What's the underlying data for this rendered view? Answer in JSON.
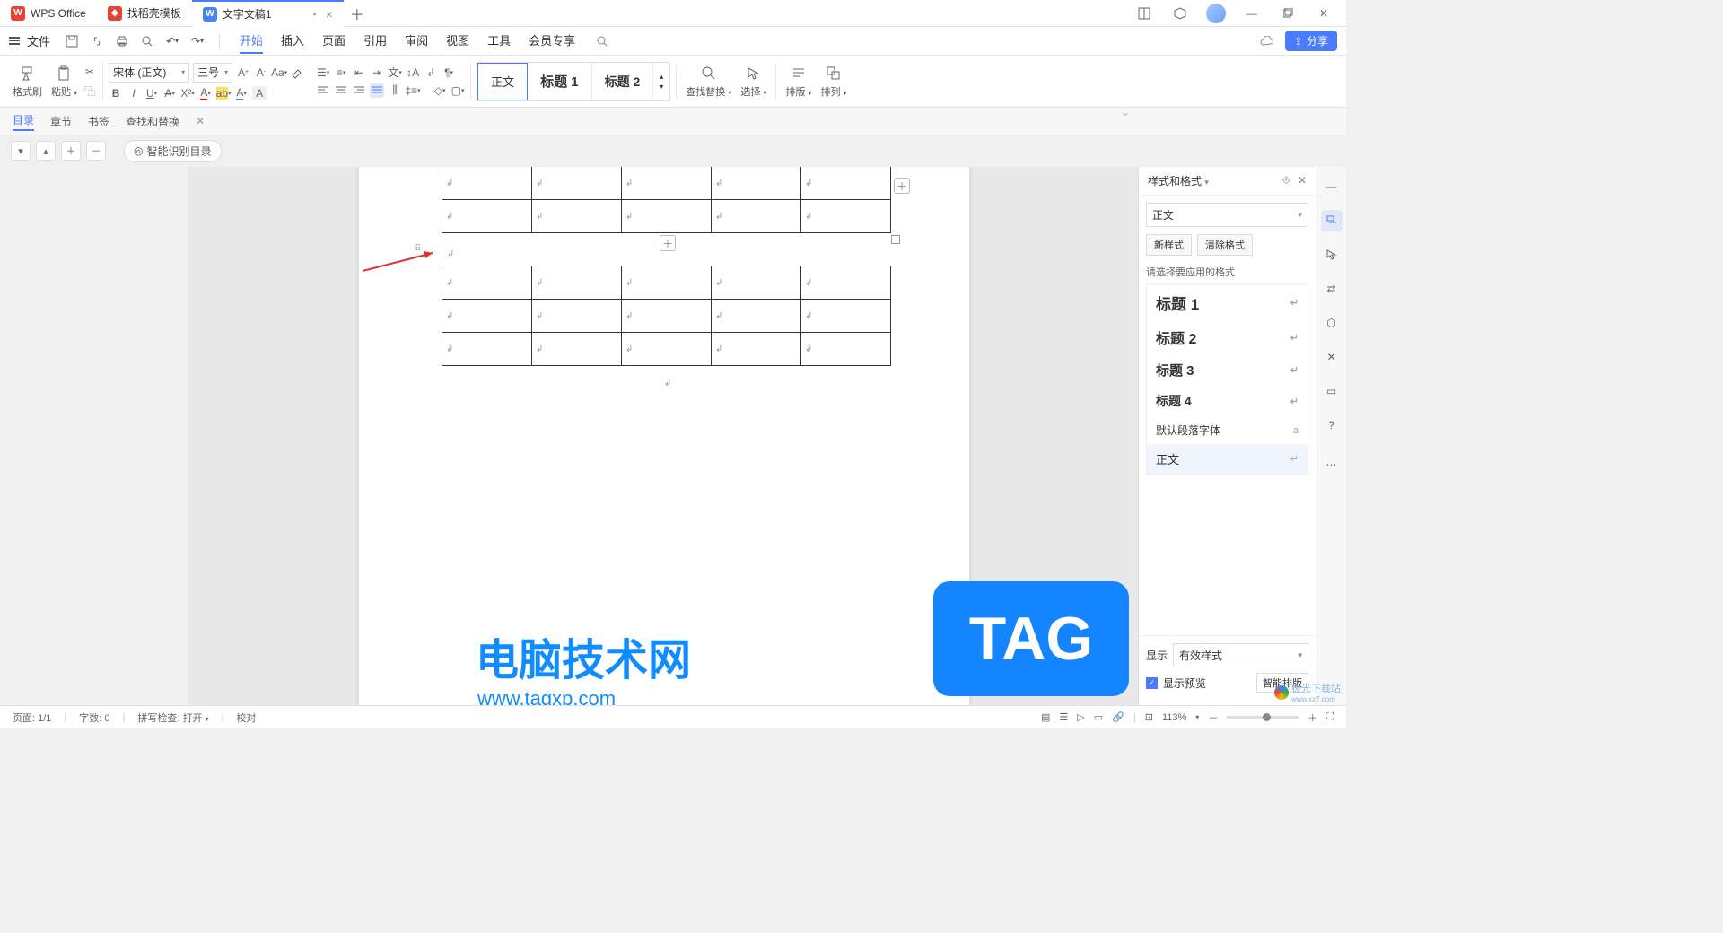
{
  "titlebar": {
    "tabs": [
      {
        "icon": "W",
        "label": "WPS Office"
      },
      {
        "icon": "D",
        "label": "找稻壳模板"
      },
      {
        "icon": "W",
        "label": "文字文稿1"
      }
    ],
    "modified_dot": "•"
  },
  "menubar": {
    "file": "文件",
    "tabs": [
      "开始",
      "插入",
      "页面",
      "引用",
      "审阅",
      "视图",
      "工具",
      "会员专享"
    ],
    "active": "开始",
    "share": "分享"
  },
  "ribbon": {
    "format_brush": "格式刷",
    "paste": "粘贴",
    "font_name": "宋体 (正文)",
    "font_size": "三号",
    "styles": {
      "normal": "正文",
      "h1": "标题 1",
      "h2": "标题 2"
    },
    "find_replace": "查找替换",
    "select": "选择",
    "layout": "排版",
    "arrange": "排列"
  },
  "subtoolbar": {
    "tabs": [
      "目录",
      "章节",
      "书签",
      "查找和替换"
    ],
    "active": "目录"
  },
  "outline": {
    "smart": "智能识别目录"
  },
  "right_panel": {
    "title": "样式和格式",
    "current": "正文",
    "new_style": "新样式",
    "clear_format": "清除格式",
    "prompt": "请选择要应用的格式",
    "items": [
      {
        "label": "标题 1",
        "cls": "h1"
      },
      {
        "label": "标题 2",
        "cls": "h2"
      },
      {
        "label": "标题 3",
        "cls": "h3"
      },
      {
        "label": "标题 4",
        "cls": "h4"
      },
      {
        "label": "默认段落字体",
        "cls": "default"
      },
      {
        "label": "正文",
        "cls": "body"
      }
    ],
    "display_label": "显示",
    "display_value": "有效样式",
    "preview": "显示预览",
    "smart_layout": "智能排版"
  },
  "statusbar": {
    "page": "页面: 1/1",
    "words": "字数: 0",
    "spell": "拼写检查: 打开",
    "proof": "校对",
    "zoom": "113%"
  },
  "watermark": {
    "title": "电脑技术网",
    "url": "www.tagxp.com",
    "tag": "TAG"
  },
  "corner": {
    "text": "极光下载站",
    "sub": "www.xz7.com"
  }
}
